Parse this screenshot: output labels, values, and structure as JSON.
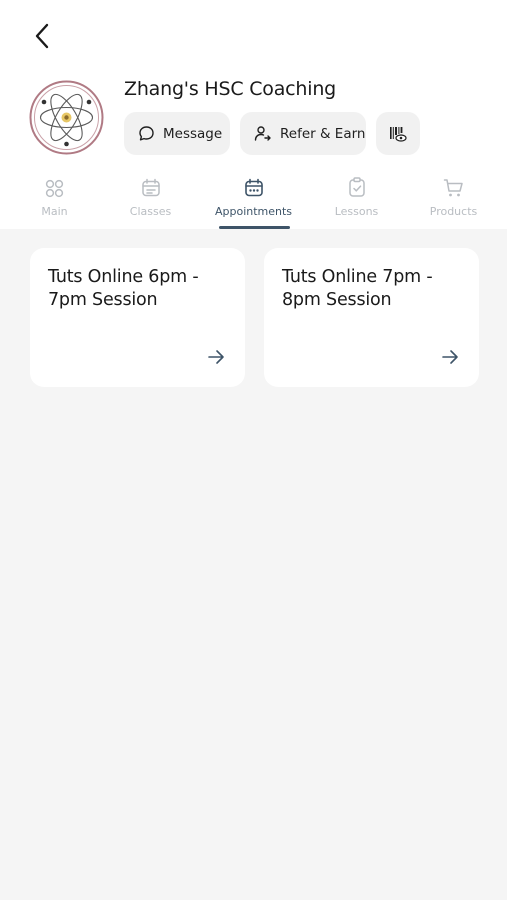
{
  "header": {
    "title": "Zhang's HSC Coaching"
  },
  "actions": {
    "message_label": "Message",
    "refer_label": "Refer & Earn"
  },
  "tabs": [
    {
      "label": "Main",
      "icon": "grid-icon"
    },
    {
      "label": "Classes",
      "icon": "calendar-icon"
    },
    {
      "label": "Appointments",
      "icon": "calendar-dots-icon",
      "active": true
    },
    {
      "label": "Lessons",
      "icon": "clipboard-check-icon"
    },
    {
      "label": "Products",
      "icon": "cart-icon"
    }
  ],
  "appointments": [
    {
      "title": "Tuts Online 6pm - 7pm Session"
    },
    {
      "title": "Tuts Online 7pm - 8pm Session"
    }
  ],
  "colors": {
    "accent": "#3e5468",
    "inactive": "#b9bdc2",
    "background": "#f5f5f5",
    "logo_ring": "#b07a84"
  }
}
